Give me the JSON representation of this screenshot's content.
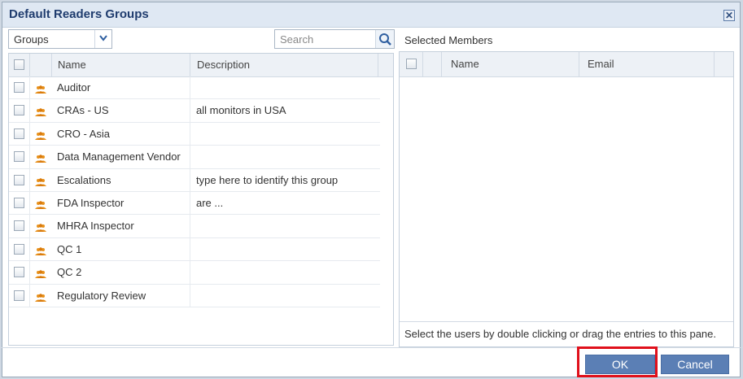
{
  "dialog": {
    "title": "Default Readers Groups",
    "close_label": "✕"
  },
  "left": {
    "dropdown_value": "Groups",
    "search_placeholder": "Search",
    "columns": {
      "name": "Name",
      "description": "Description"
    },
    "rows": [
      {
        "name": "Auditor",
        "description": ""
      },
      {
        "name": "CRAs - US",
        "description": "all monitors in USA"
      },
      {
        "name": "CRO - Asia",
        "description": ""
      },
      {
        "name": "Data Management Vendor",
        "description": ""
      },
      {
        "name": "Escalations",
        "description": "type here to identify this group"
      },
      {
        "name": "FDA Inspector",
        "description": "are ..."
      },
      {
        "name": "MHRA Inspector",
        "description": ""
      },
      {
        "name": "QC 1",
        "description": ""
      },
      {
        "name": "QC 2",
        "description": ""
      },
      {
        "name": "Regulatory Review",
        "description": ""
      }
    ]
  },
  "right": {
    "title": "Selected Members",
    "columns": {
      "name": "Name",
      "email": "Email"
    },
    "hint": "Select the users by double clicking or drag the entries to this pane."
  },
  "buttons": {
    "ok": "OK",
    "cancel": "Cancel"
  },
  "icons": {
    "group_icon_color": "#e8921c",
    "accent": "#5b7fb5",
    "highlight": "#e0101b"
  }
}
